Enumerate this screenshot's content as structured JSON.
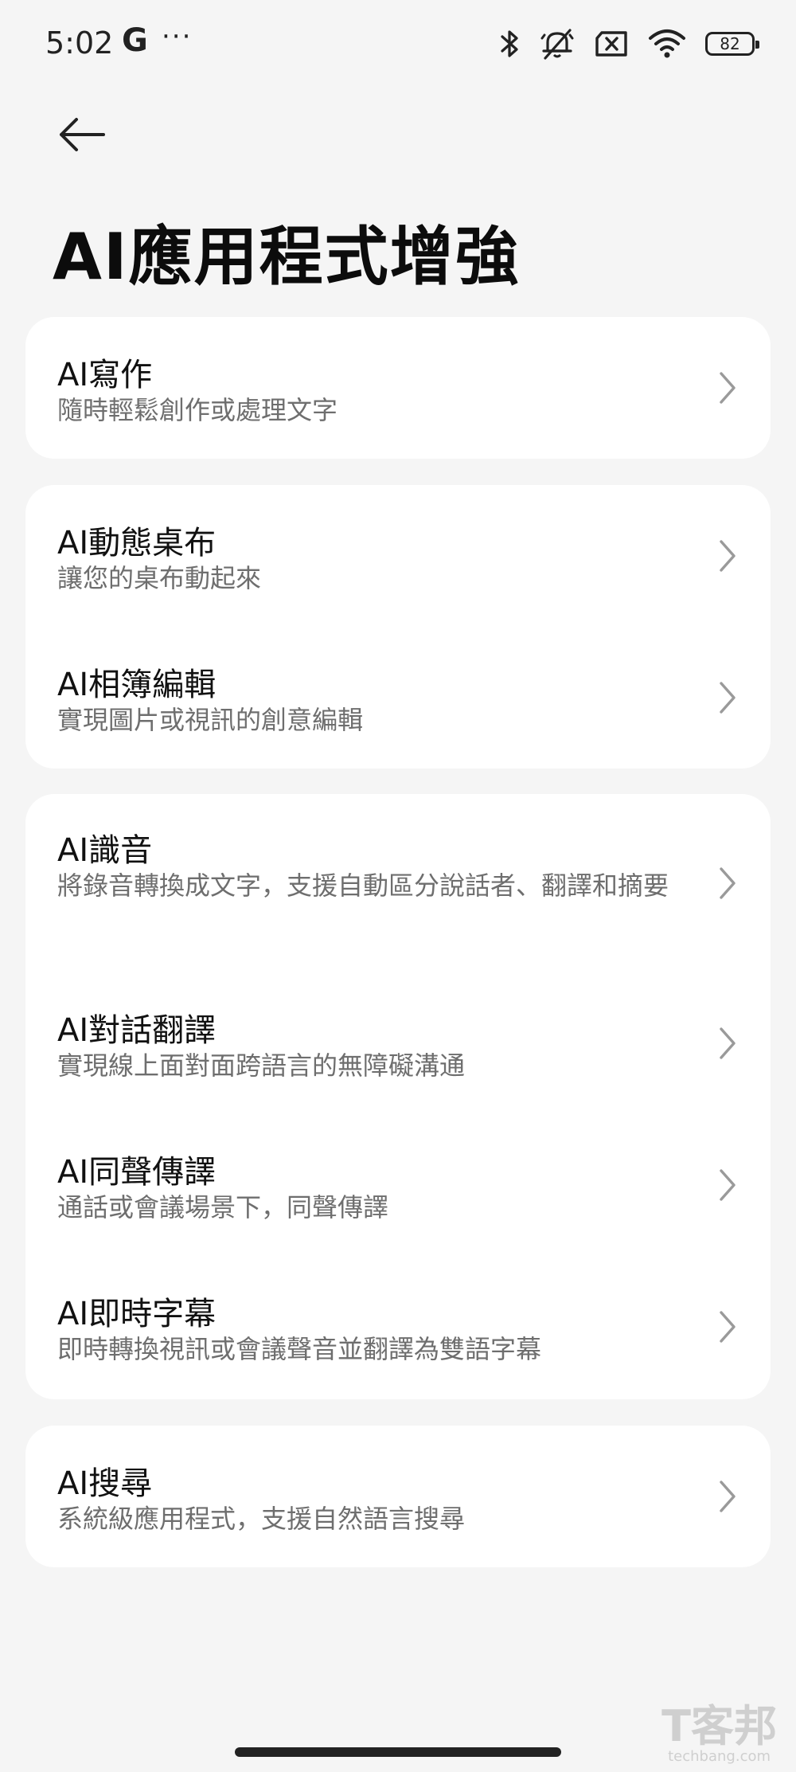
{
  "status_bar": {
    "time": "5:02",
    "g_label": "G",
    "more": "···",
    "battery": "82"
  },
  "page": {
    "title": "AI應用程式增強"
  },
  "cards": [
    {
      "items": [
        {
          "title": "AI寫作",
          "subtitle": "隨時輕鬆創作或處理文字"
        }
      ]
    },
    {
      "items": [
        {
          "title": "AI動態桌布",
          "subtitle": "讓您的桌布動起來"
        },
        {
          "title": "AI相簿編輯",
          "subtitle": "實現圖片或視訊的創意編輯"
        }
      ]
    },
    {
      "items": [
        {
          "title": "AI識音",
          "subtitle": "將錄音轉換成文字，支援自動區分說話者、翻譯和摘要"
        },
        {
          "title": "AI對話翻譯",
          "subtitle": "實現線上面對面跨語言的無障礙溝通"
        },
        {
          "title": "AI同聲傳譯",
          "subtitle": "通話或會議場景下，同聲傳譯"
        },
        {
          "title": "AI即時字幕",
          "subtitle": "即時轉換視訊或會議聲音並翻譯為雙語字幕"
        }
      ]
    },
    {
      "items": [
        {
          "title": "AI搜尋",
          "subtitle": "系統級應用程式，支援自然語言搜尋"
        }
      ]
    }
  ],
  "watermark": {
    "line1": "T客邦",
    "line2": "techbang.com"
  },
  "colors": {
    "background": "#f5f5f5",
    "card": "#ffffff",
    "subtitle": "#6e6e6e",
    "chevron": "#9a9a9a"
  }
}
